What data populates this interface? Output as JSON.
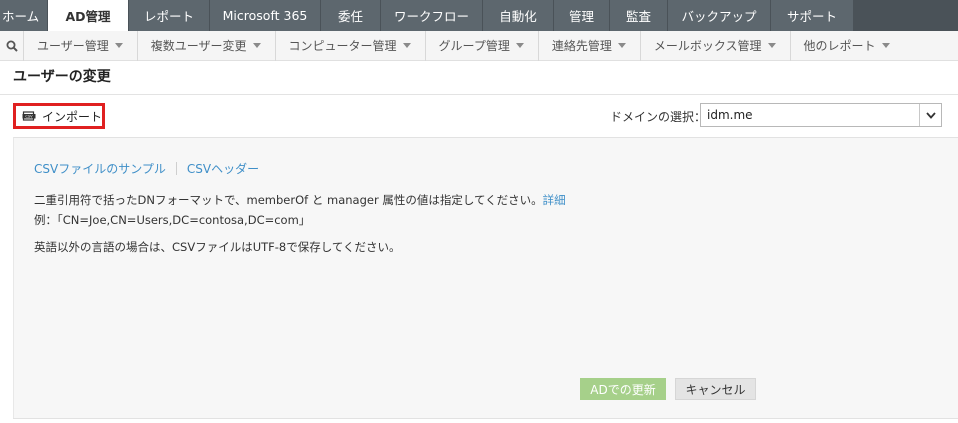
{
  "topnav": {
    "tabs": [
      {
        "label": "ホーム"
      },
      {
        "label": "AD管理",
        "active": true
      },
      {
        "label": "レポート"
      },
      {
        "label": "Microsoft 365"
      },
      {
        "label": "委任"
      },
      {
        "label": "ワークフロー"
      },
      {
        "label": "自動化"
      },
      {
        "label": "管理"
      },
      {
        "label": "監査"
      },
      {
        "label": "バックアップ"
      },
      {
        "label": "サポート"
      }
    ]
  },
  "subnav": {
    "search_icon": "search-icon",
    "items": [
      {
        "label": "ユーザー管理"
      },
      {
        "label": "複数ユーザー変更"
      },
      {
        "label": "コンピューター管理"
      },
      {
        "label": "グループ管理"
      },
      {
        "label": "連絡先管理"
      },
      {
        "label": "メールボックス管理"
      },
      {
        "label": "他のレポート"
      }
    ]
  },
  "page": {
    "title": "ユーザーの変更"
  },
  "toolbar": {
    "import_label": "インポート",
    "import_icon": "csv-import-icon",
    "domain_label": "ドメインの選択：",
    "domain_value": "idm.me"
  },
  "content": {
    "link_sample": "CSVファイルのサンプル",
    "link_header": "CSVヘッダー",
    "info_line1": "二重引用符で括ったDNフォーマットで、memberOf と manager 属性の値は指定してください。",
    "info_line1_link": "詳細",
    "info_line2": "例：「CN=Joe,CN=Users,DC=contosa,DC=com」",
    "info_line3": "英語以外の言語の場合は、CSVファイルはUTF-8で保存してください。"
  },
  "actions": {
    "update_label": "ADでの更新",
    "cancel_label": "キャンセル"
  },
  "colors": {
    "topnav_bg": "#5d676e",
    "link": "#3f8fc8",
    "highlight": "#e02020",
    "update_button": "#a6d08a"
  }
}
